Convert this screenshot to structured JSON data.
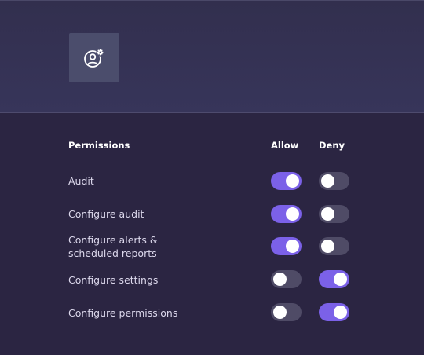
{
  "header": {
    "icon": "user-settings-icon"
  },
  "permissions": {
    "columns": {
      "permissions": "Permissions",
      "allow": "Allow",
      "deny": "Deny"
    },
    "rows": [
      {
        "label": "Audit",
        "allow": true,
        "deny": false
      },
      {
        "label": "Configure audit",
        "allow": true,
        "deny": false
      },
      {
        "label_line1": "Configure alerts &",
        "label_line2": "scheduled reports",
        "allow": true,
        "deny": false
      },
      {
        "label": "Configure settings",
        "allow": false,
        "deny": true
      },
      {
        "label": "Configure permissions",
        "allow": false,
        "deny": true
      }
    ]
  },
  "colors": {
    "toggle_on": "#7b61e8",
    "toggle_off": "#4f4b66",
    "background": "#2b2542"
  }
}
